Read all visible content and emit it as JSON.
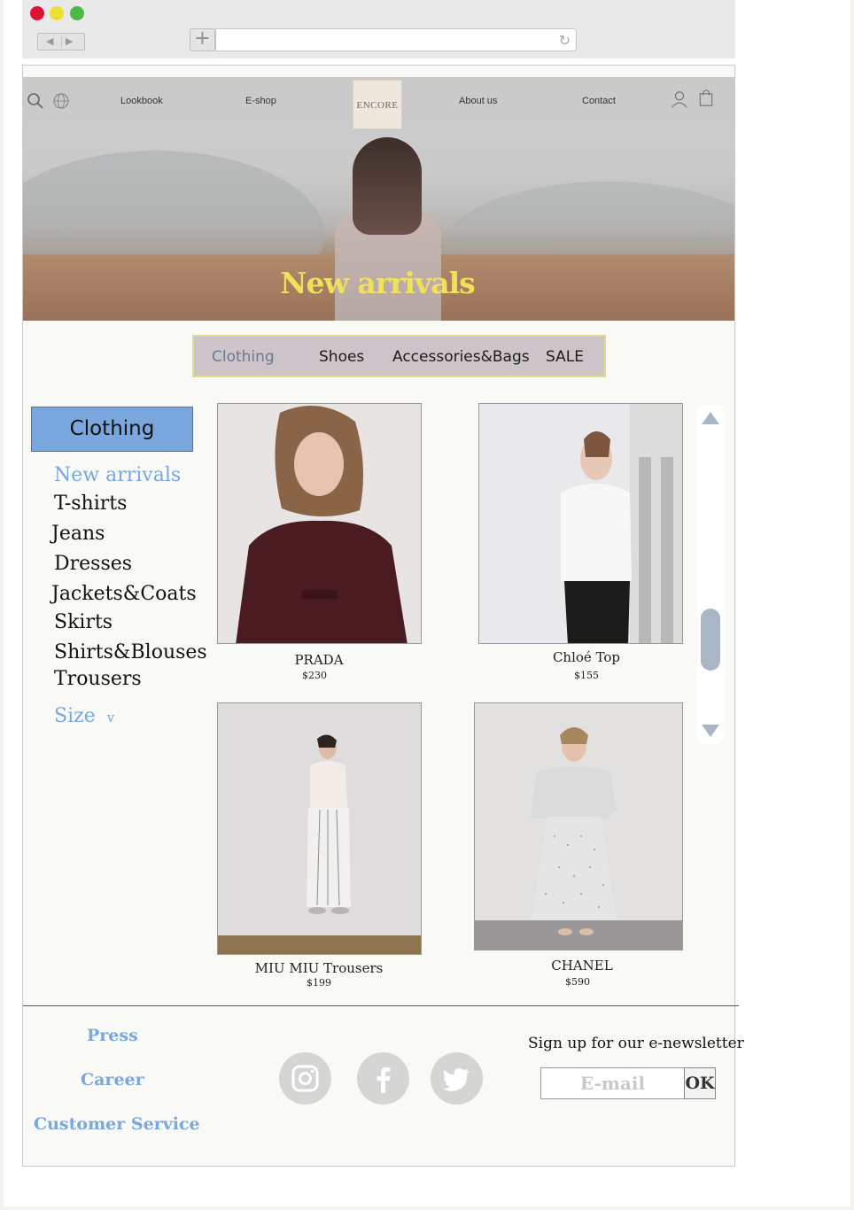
{
  "browser": {
    "back_glyph": "◀",
    "forward_glyph": "▶",
    "new_tab_glyph": "+",
    "reload_glyph": "↻",
    "url": ""
  },
  "nav": {
    "links": [
      "Lookbook",
      "E-shop",
      "About us",
      "Contact"
    ],
    "logo": "ENCORE",
    "icons": [
      "search-icon",
      "globe-icon",
      "user-icon",
      "shopping-bag-icon"
    ]
  },
  "hero": {
    "title": "New arrivals",
    "prev_glyph": "‹",
    "next_glyph": "›"
  },
  "category_tabs": [
    "Clothing",
    "Shoes",
    "Accessories&Bags",
    "SALE"
  ],
  "active_tab": "Clothing",
  "sidebar": {
    "heading": "Clothing",
    "items": [
      "New arrivals",
      "T-shirts",
      "Jeans",
      "Dresses",
      "Jackets&Coats",
      "Skirts",
      "Shirts&Blouses",
      "Trousers"
    ],
    "active_item": "New arrivals",
    "size_label": "Size",
    "size_glyph": "v"
  },
  "products": [
    {
      "name": "PRADA",
      "price": "$230"
    },
    {
      "name": "Chloé Top",
      "price": "$155"
    },
    {
      "name": "MIU MIU Trousers",
      "price": "$199"
    },
    {
      "name": "CHANEL",
      "price": "$590"
    }
  ],
  "footer": {
    "links": [
      "Press",
      "Career",
      "Customer Service"
    ],
    "social": [
      "instagram-icon",
      "facebook-icon",
      "twitter-icon"
    ],
    "newsletter_label": "Sign up for our e-newsletter",
    "email_placeholder": "E-mail",
    "ok_label": "OK"
  },
  "colors": {
    "accent_blue": "#7aa7dd",
    "hero_title": "#f1e15a",
    "tab_bar": "#ccc4c9"
  }
}
